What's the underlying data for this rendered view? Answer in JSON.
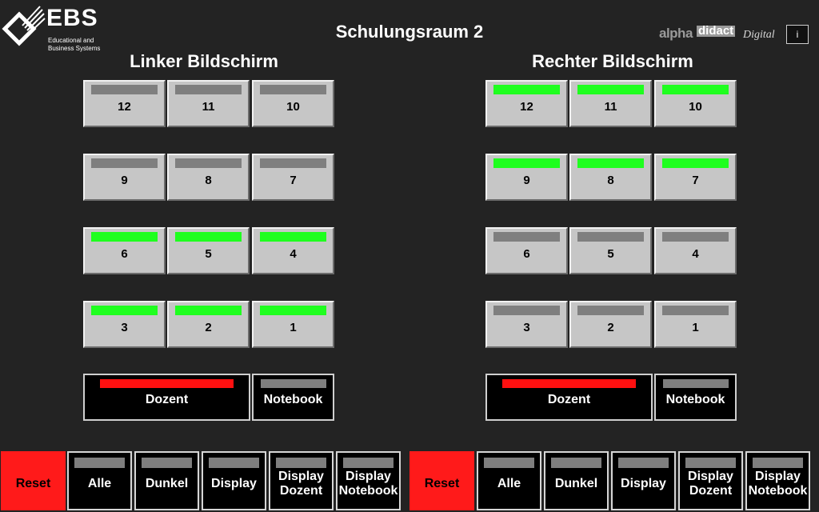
{
  "header": {
    "logo_text": "EBS",
    "logo_sub_line1": "Educational and",
    "logo_sub_line2": "Business Systems",
    "title": "Schulungsraum 2",
    "brand_alpha": "alpha",
    "brand_didact": "didact",
    "brand_digital": "Digital",
    "info_label": "i"
  },
  "left": {
    "title": "Linker Bildschirm",
    "sources": [
      {
        "label": "12",
        "active": false
      },
      {
        "label": "11",
        "active": false
      },
      {
        "label": "10",
        "active": false
      },
      {
        "label": "9",
        "active": false
      },
      {
        "label": "8",
        "active": false
      },
      {
        "label": "7",
        "active": false
      },
      {
        "label": "6",
        "active": true
      },
      {
        "label": "5",
        "active": true
      },
      {
        "label": "4",
        "active": true
      },
      {
        "label": "3",
        "active": true
      },
      {
        "label": "2",
        "active": true
      },
      {
        "label": "1",
        "active": true
      }
    ],
    "dozent_label": "Dozent",
    "notebook_label": "Notebook"
  },
  "right": {
    "title": "Rechter Bildschirm",
    "sources": [
      {
        "label": "12",
        "active": true
      },
      {
        "label": "11",
        "active": true
      },
      {
        "label": "10",
        "active": true
      },
      {
        "label": "9",
        "active": true
      },
      {
        "label": "8",
        "active": true
      },
      {
        "label": "7",
        "active": true
      },
      {
        "label": "6",
        "active": false
      },
      {
        "label": "5",
        "active": false
      },
      {
        "label": "4",
        "active": false
      },
      {
        "label": "3",
        "active": false
      },
      {
        "label": "2",
        "active": false
      },
      {
        "label": "1",
        "active": false
      }
    ],
    "dozent_label": "Dozent",
    "notebook_label": "Notebook"
  },
  "bottom": {
    "left": {
      "reset": "Reset",
      "alle": "Alle",
      "dunkel": "Dunkel",
      "display": "Display",
      "display_dozent_1": "Display",
      "display_dozent_2": "Dozent",
      "display_notebook_1": "Display",
      "display_notebook_2": "Notebook"
    },
    "right": {
      "reset": "Reset",
      "alle": "Alle",
      "dunkel": "Dunkel",
      "display": "Display",
      "display_dozent_1": "Display",
      "display_dozent_2": "Dozent",
      "display_notebook_1": "Display",
      "display_notebook_2": "Notebook"
    }
  },
  "colors": {
    "background": "#232323",
    "led_on": "#1fff1f",
    "led_off": "#7f7f7f",
    "dozent_led": "#ff1010",
    "reset": "#ff1a1a"
  }
}
